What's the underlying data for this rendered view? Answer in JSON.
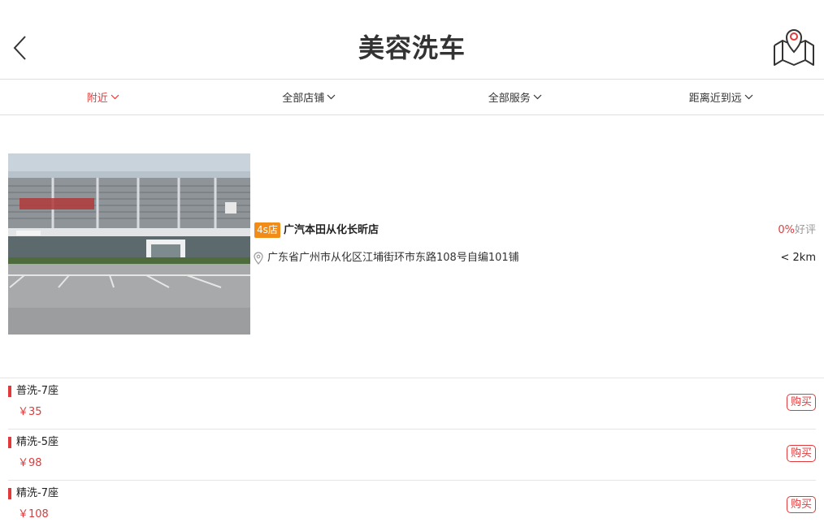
{
  "header": {
    "title": "美容洗车",
    "back_icon": "chevron-left-icon",
    "map_icon": "map-location-icon"
  },
  "filters": [
    {
      "label": "附近",
      "active": true
    },
    {
      "label": "全部店铺",
      "active": false
    },
    {
      "label": "全部服务",
      "active": false
    },
    {
      "label": "距离近到远",
      "active": false
    }
  ],
  "store": {
    "badge": "4s店",
    "name": "广汽本田从化长昕店",
    "rating_value": "0%",
    "rating_label": "好评",
    "address": "广东省广州市从化区江埔街环市东路108号自编101铺",
    "distance": "< 2km"
  },
  "services": [
    {
      "name": "普洗-7座",
      "price": "￥35",
      "buy_label": "购买"
    },
    {
      "name": "精洗-5座",
      "price": "￥98",
      "buy_label": "购买"
    },
    {
      "name": "精洗-7座",
      "price": "￥108",
      "buy_label": "购买"
    }
  ],
  "colors": {
    "accent": "#e23a3a",
    "badge": "#f08c17",
    "divider": "#dddddd"
  }
}
